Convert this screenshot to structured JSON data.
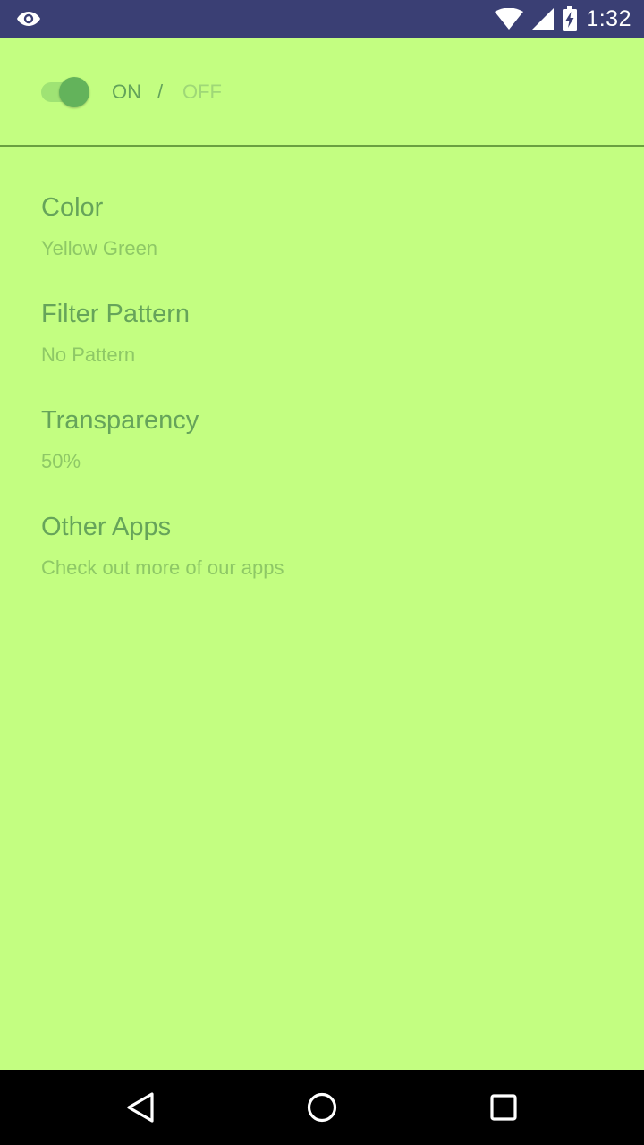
{
  "status_bar": {
    "time": "1:32",
    "icons": [
      "eye-icon",
      "wifi-icon",
      "cellular-signal-icon",
      "battery-charging-icon"
    ]
  },
  "overlay_toggle": {
    "on_label": "ON",
    "separator": "/",
    "off_label": "OFF",
    "state": "on"
  },
  "settings": [
    {
      "title": "Color",
      "subtitle": "Yellow Green"
    },
    {
      "title": "Filter Pattern",
      "subtitle": "No Pattern"
    },
    {
      "title": "Transparency",
      "subtitle": "50%"
    },
    {
      "title": "Other Apps",
      "subtitle": "Check out more of our apps"
    }
  ],
  "nav_bar": {
    "icons": [
      "back-icon",
      "home-icon",
      "recents-icon"
    ]
  },
  "colors": {
    "background": "#c3fe81",
    "status_bar": "#3a3f74",
    "accent": "#63b35b",
    "title_text": "#66a45a",
    "subtitle_text": "#8ec866"
  }
}
